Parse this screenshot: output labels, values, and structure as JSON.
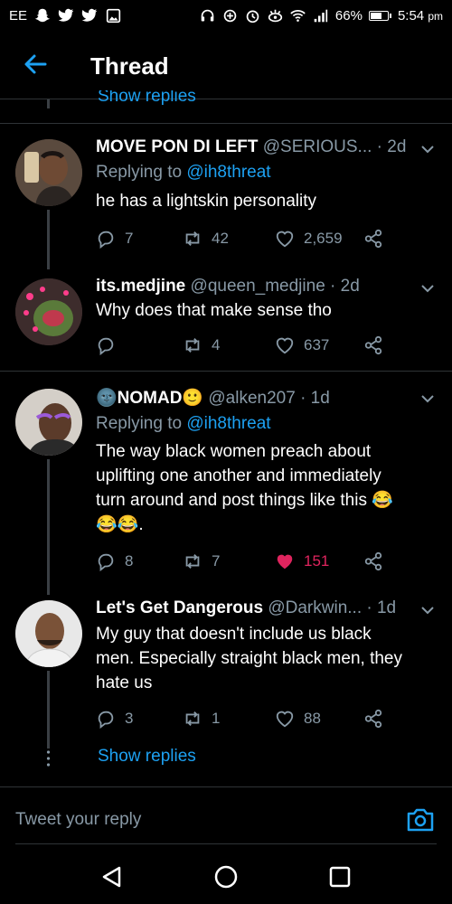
{
  "status_bar": {
    "carrier": "EE",
    "battery": "66%",
    "time": "5:54",
    "time_suffix": "pm"
  },
  "header": {
    "title": "Thread"
  },
  "top_link": "Show replies",
  "tweets": [
    {
      "name": "MOVE PON DI LEFT",
      "handle": "@SERIOUS...",
      "time": "· 2d",
      "replying_prefix": "Replying to ",
      "replying_to": "@ih8threat",
      "text": "he has a lightskin personality",
      "replies": "7",
      "retweets": "42",
      "likes": "2,659"
    },
    {
      "name": "its.medjine",
      "handle": "@queen_medjine",
      "time": "· 2d",
      "text": "Why does that make sense tho",
      "replies": "",
      "retweets": "4",
      "likes": "637"
    },
    {
      "name": "🌚NOMAD🙂",
      "handle": "@alken207",
      "time": "· 1d",
      "replying_prefix": "Replying to ",
      "replying_to": "@ih8threat",
      "text_lines": [
        "The way black women preach about",
        "uplifting one another and immediately",
        "turn around and post things like this 😂",
        "😂😂."
      ],
      "replies": "8",
      "retweets": "7",
      "likes": "151",
      "liked": true
    },
    {
      "name": "Let's Get Dangerous",
      "handle": "@Darkwin...",
      "time": "· 1d",
      "text_lines": [
        "My guy that doesn't include us black",
        "men. Especially straight black men, they",
        "hate us"
      ],
      "replies": "3",
      "retweets": "1",
      "likes": "88"
    }
  ],
  "show_replies": "Show replies",
  "composer": {
    "placeholder": "Tweet your reply"
  },
  "colors": {
    "accent": "#1da1f2",
    "like": "#e0245e",
    "muted": "#8899a6",
    "background": "#000000"
  }
}
